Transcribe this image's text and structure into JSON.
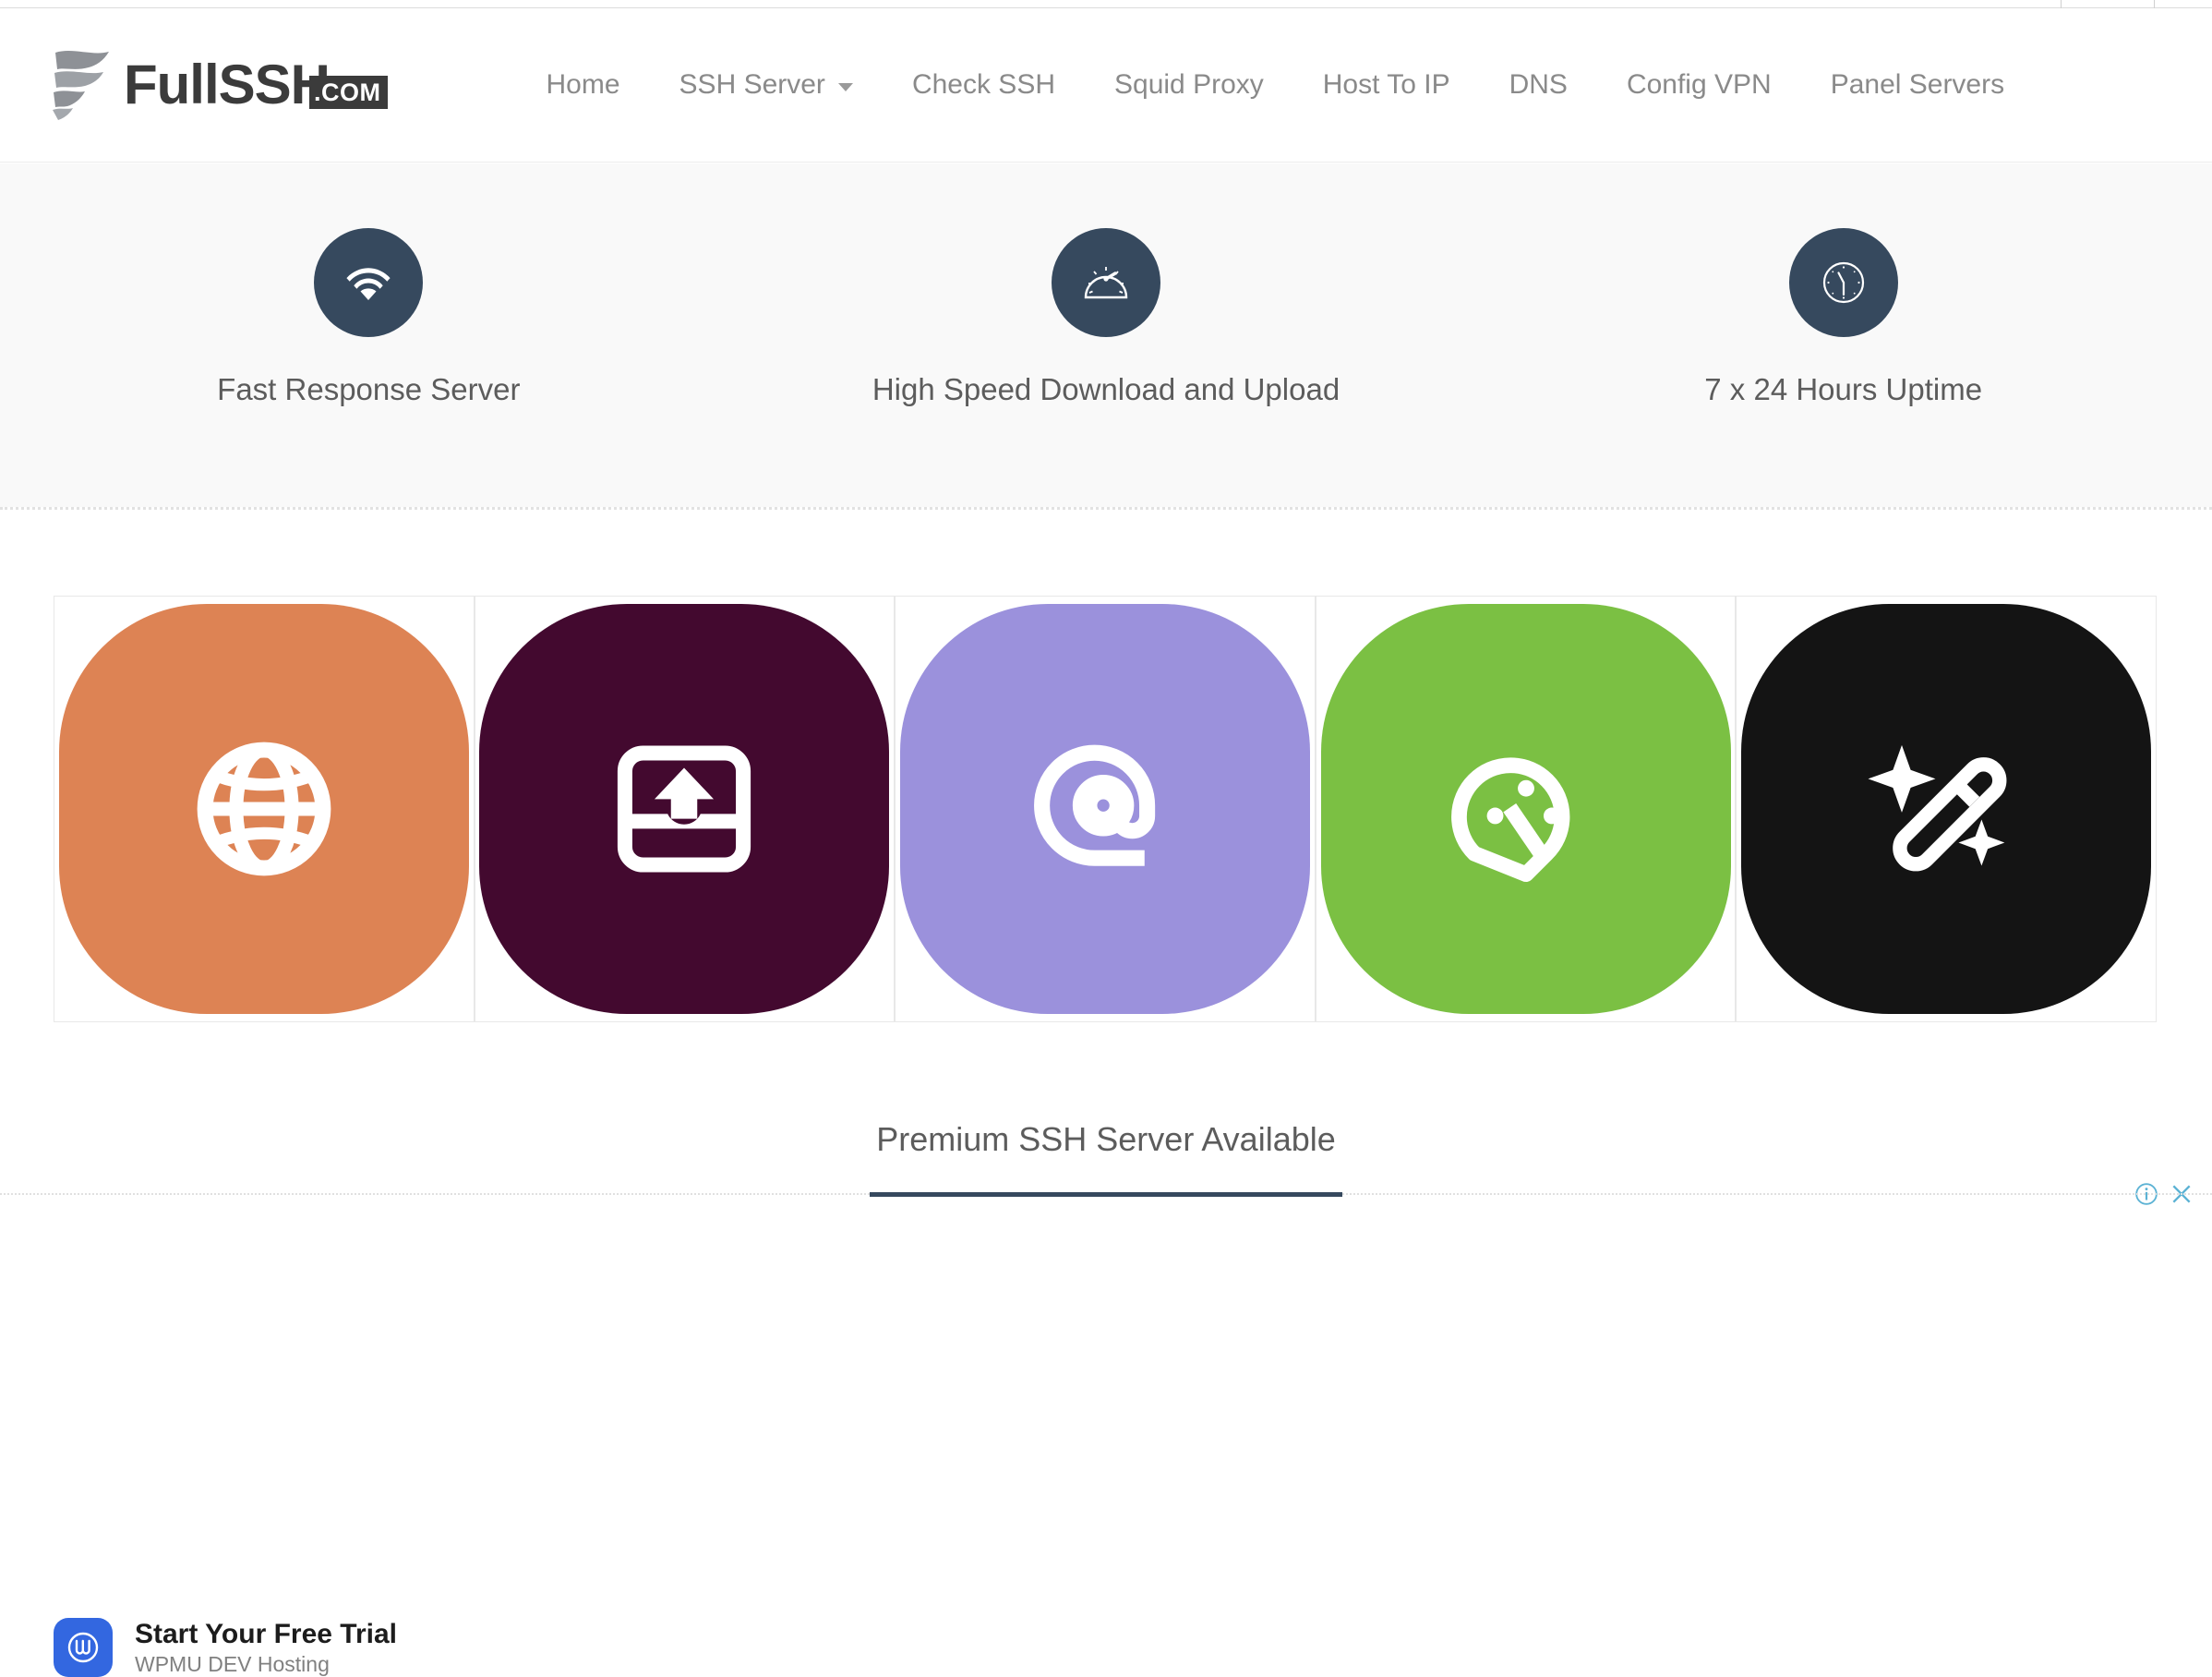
{
  "brand": {
    "name": "FullSSH",
    "tld": ".COM",
    "logo_icon": "flag-swoosh-logo-icon"
  },
  "nav": {
    "items": [
      {
        "label": "Home",
        "has_dropdown": false
      },
      {
        "label": "SSH Server",
        "has_dropdown": true
      },
      {
        "label": "Check SSH",
        "has_dropdown": false
      },
      {
        "label": "Squid Proxy",
        "has_dropdown": false
      },
      {
        "label": "Host To IP",
        "has_dropdown": false
      },
      {
        "label": "DNS",
        "has_dropdown": false
      },
      {
        "label": "Config VPN",
        "has_dropdown": false
      },
      {
        "label": "Panel Servers",
        "has_dropdown": false
      }
    ]
  },
  "features": {
    "circle_color": "#36495e",
    "items": [
      {
        "label": "Fast Response Server",
        "icon": "wifi-icon"
      },
      {
        "label": "High Speed Download and Upload",
        "icon": "speedometer-icon"
      },
      {
        "label": "7 x 24 Hours Uptime",
        "icon": "clock-icon"
      }
    ]
  },
  "advertisement": {
    "tiles": [
      {
        "icon": "globe-icon",
        "bg": "#dd8354"
      },
      {
        "icon": "upload-inbox-icon",
        "bg": "#43092f"
      },
      {
        "icon": "at-sign-icon",
        "bg": "#9b91dc"
      },
      {
        "icon": "gauge-icon",
        "bg": "#7bc043"
      },
      {
        "icon": "magic-wand-icon",
        "bg": "#141414"
      }
    ],
    "controls": {
      "info_icon": "info-circle-icon",
      "close_icon": "close-icon",
      "color": "#5bb2d4"
    },
    "footer": {
      "avatar_icon": "wpmu-dev-logo-icon",
      "title": "Start Your Free Trial",
      "subtitle": "WPMU DEV Hosting",
      "avatar_color": "#3367e0"
    }
  },
  "section": {
    "heading": "Premium SSH Server Available",
    "accent_color": "#36495e"
  }
}
